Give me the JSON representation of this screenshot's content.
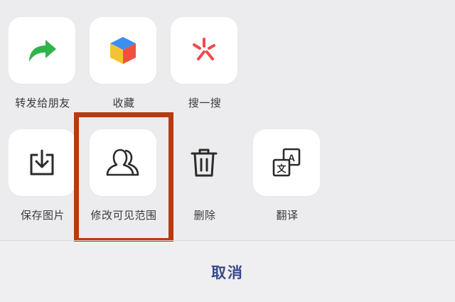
{
  "share_sheet": {
    "row1": [
      {
        "label": "转发给朋友",
        "icon": "forward-arrow-icon"
      },
      {
        "label": "收藏",
        "icon": "favorite-cube-icon"
      },
      {
        "label": "搜一搜",
        "icon": "search-spark-icon"
      }
    ],
    "row2": [
      {
        "label": "保存图片",
        "icon": "save-download-icon"
      },
      {
        "label": "修改可见范围",
        "icon": "people-visibility-icon"
      },
      {
        "label": "删除",
        "icon": "trash-icon"
      },
      {
        "label": "翻译",
        "icon": "translate-icon"
      }
    ],
    "cancel_label": "取消",
    "icon_glyphs": {
      "translate_zh": "文",
      "translate_en": "A"
    }
  },
  "colors": {
    "background": "#ececee",
    "tile": "#ffffff",
    "highlight_border": "#b63b10",
    "cancel_text": "#3a4a8a",
    "forward_green": "#2fb44a"
  }
}
